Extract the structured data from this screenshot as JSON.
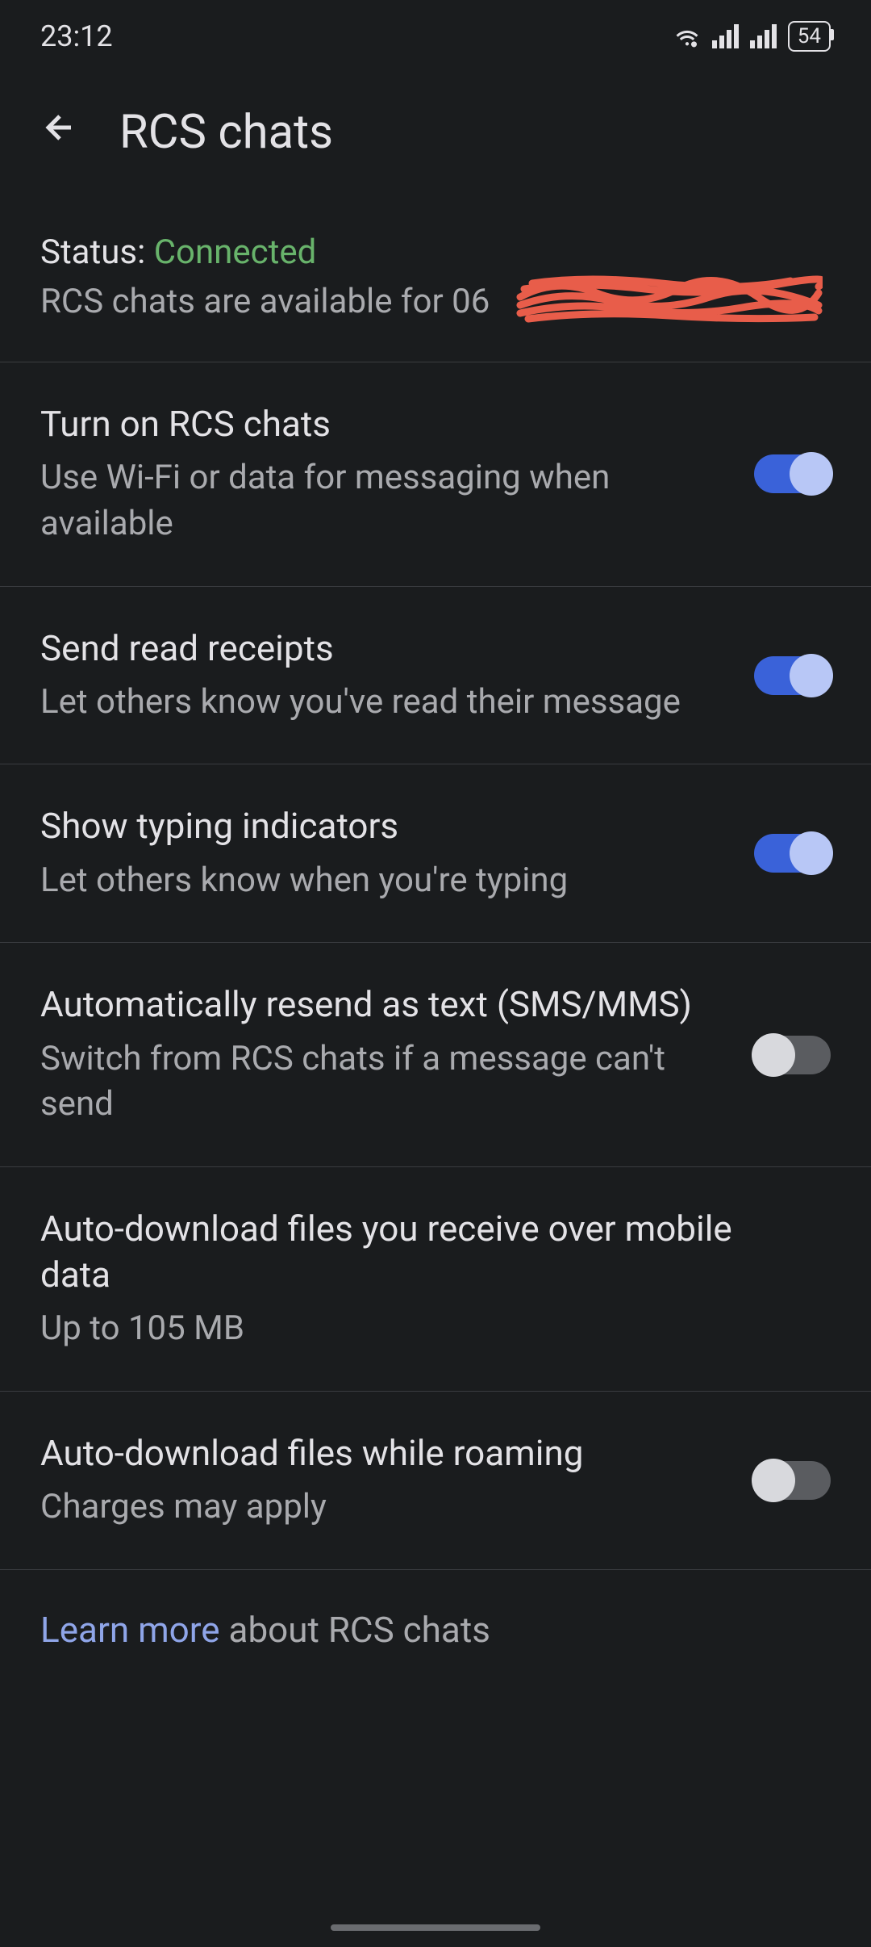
{
  "statusBar": {
    "time": "23:12",
    "battery": "54"
  },
  "header": {
    "title": "RCS chats"
  },
  "status": {
    "label": "Status: ",
    "value": "Connected",
    "subtext": "RCS chats are available for 06"
  },
  "settings": [
    {
      "title": "Turn on RCS chats",
      "subtitle": "Use Wi-Fi or data for messaging when available",
      "toggle": true
    },
    {
      "title": "Send read receipts",
      "subtitle": "Let others know you've read their message",
      "toggle": true
    },
    {
      "title": "Show typing indicators",
      "subtitle": "Let others know when you're typing",
      "toggle": true
    },
    {
      "title": "Automatically resend as text (SMS/MMS)",
      "subtitle": "Switch from RCS chats if a message can't send",
      "toggle": false
    },
    {
      "title": "Auto-download files you receive over mobile data",
      "subtitle": "Up to 105 MB",
      "toggle": null
    },
    {
      "title": "Auto-download files while roaming",
      "subtitle": "Charges may apply",
      "toggle": false
    }
  ],
  "learnMore": {
    "link": "Learn more",
    "text": " about RCS chats"
  }
}
